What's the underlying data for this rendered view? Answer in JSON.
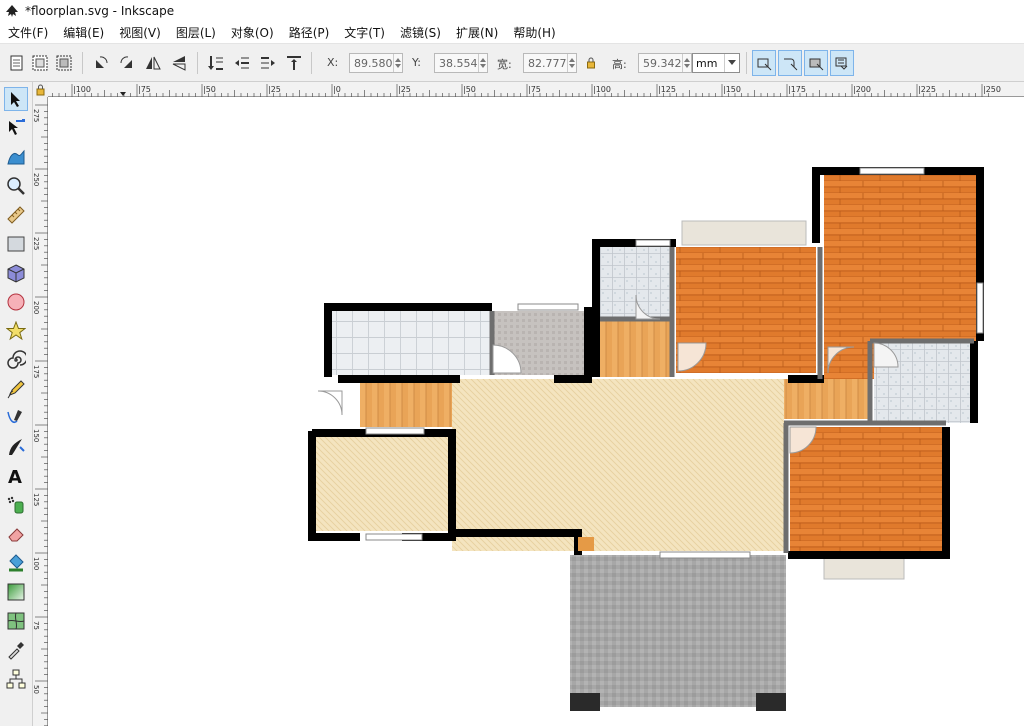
{
  "window": {
    "title": "*floorplan.svg - Inkscape"
  },
  "menu": [
    {
      "id": "file",
      "label": "文件(F)"
    },
    {
      "id": "edit",
      "label": "编辑(E)"
    },
    {
      "id": "view",
      "label": "视图(V)"
    },
    {
      "id": "layer",
      "label": "图层(L)"
    },
    {
      "id": "object",
      "label": "对象(O)"
    },
    {
      "id": "path",
      "label": "路径(P)"
    },
    {
      "id": "text",
      "label": "文字(T)"
    },
    {
      "id": "filters",
      "label": "滤镜(S)"
    },
    {
      "id": "extensions",
      "label": "扩展(N)"
    },
    {
      "id": "help",
      "label": "帮助(H)"
    }
  ],
  "toolbar": {
    "x_label": "X:",
    "x_value": "89.580",
    "y_label": "Y:",
    "y_value": "38.554",
    "w_label": "宽:",
    "w_value": "82.777",
    "h_label": "高:",
    "h_value": "59.342",
    "unit": "mm"
  },
  "ruler": {
    "h_labels": [
      "|100",
      "|75",
      "|50",
      "|25",
      "|0",
      "|25",
      "|50",
      "|75",
      "|100",
      "|125",
      "|150",
      "|175",
      "|200",
      "|225",
      "|250"
    ],
    "v_labels": [
      "275",
      "250",
      "225",
      "200",
      "175",
      "150",
      "125",
      "100",
      "75",
      "50"
    ]
  },
  "colors": {
    "wall": "#000000",
    "wood": "#e07a2c",
    "light_wood": "#f4e4bf",
    "tile": "#dfe3e7",
    "stone": "#a7a7a7",
    "active_tool": "#cde6f7"
  },
  "icons": [
    "select-tool-icon",
    "node-tool-icon",
    "tweak-tool-icon",
    "zoom-tool-icon",
    "measure-tool-icon",
    "rectangle-tool-icon",
    "3d-box-tool-icon",
    "ellipse-tool-icon",
    "star-tool-icon",
    "spiral-tool-icon",
    "pencil-tool-icon",
    "pen-tool-icon",
    "calligraphy-tool-icon",
    "text-tool-icon",
    "spray-tool-icon",
    "eraser-tool-icon",
    "paint-bucket-tool-icon",
    "gradient-tool-icon",
    "mesh-tool-icon",
    "dropper-tool-icon",
    "connector-tool-icon"
  ]
}
